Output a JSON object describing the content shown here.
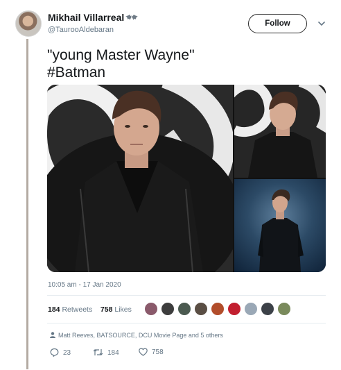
{
  "user": {
    "display_name": "Mikhail Villarreal",
    "handle": "@TaurooAldebaran",
    "follow_label": "Follow"
  },
  "tweet": {
    "text_line1": "\"young Master Wayne\"",
    "text_line2": "#Batman",
    "timestamp": "10:05 am - 17 Jan 2020"
  },
  "stats": {
    "retweets_count": "184",
    "retweets_label": "Retweets",
    "likes_count": "758",
    "likes_label": "Likes"
  },
  "liked_by": "Matt Reeves, BATSOURCE, DCU Movie Page and 5 others",
  "actions": {
    "reply_count": "23",
    "retweet_count": "184",
    "like_count": "758"
  },
  "icons": [
    "bat-icon",
    "chevron-down-icon",
    "person-icon",
    "reply-icon",
    "retweet-icon",
    "heart-icon"
  ],
  "colors": {
    "text": "#14171a",
    "secondary": "#657786",
    "divider": "#e6ecf0",
    "thread": "#b3aaa2"
  }
}
